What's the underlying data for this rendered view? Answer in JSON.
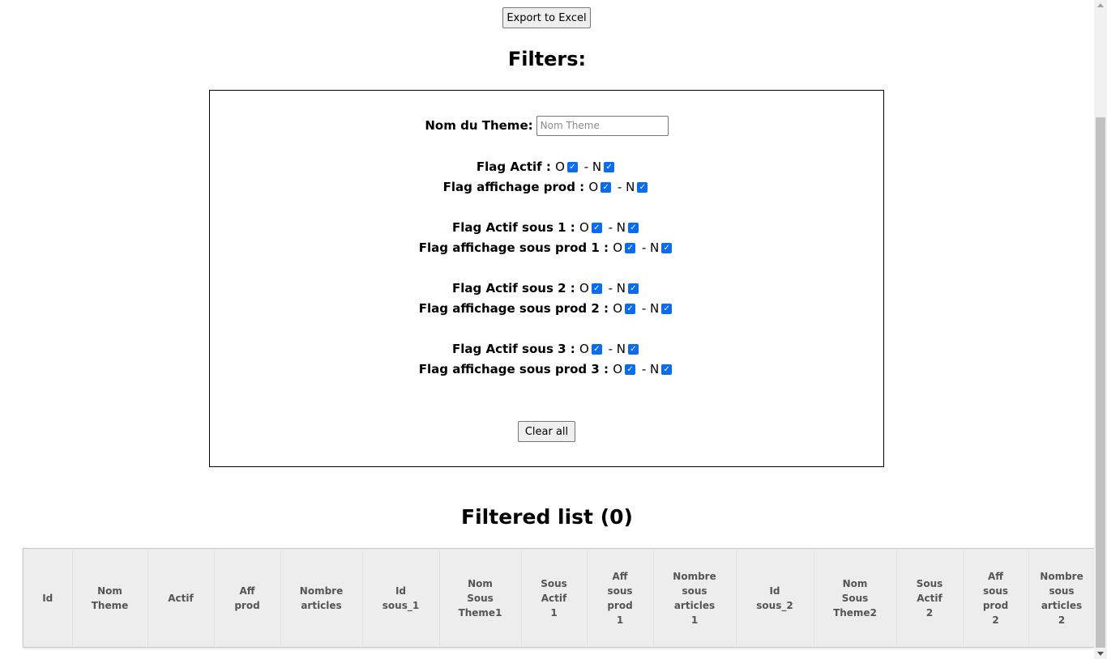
{
  "toolbar": {
    "export_label": "Export to Excel"
  },
  "filters": {
    "title": "Filters:",
    "theme_label": "Nom du Theme:",
    "theme_placeholder": "Nom Theme",
    "theme_value": "",
    "option_yes": "O",
    "option_no": " - N",
    "flags": [
      {
        "label": "Flag Actif : ",
        "o_checked": true,
        "n_checked": true
      },
      {
        "label": "Flag affichage prod : ",
        "o_checked": true,
        "n_checked": true
      },
      {
        "label": "Flag Actif sous 1 : ",
        "o_checked": true,
        "n_checked": true
      },
      {
        "label": "Flag affichage sous prod 1 : ",
        "o_checked": true,
        "n_checked": true
      },
      {
        "label": "Flag Actif sous 2 : ",
        "o_checked": true,
        "n_checked": true
      },
      {
        "label": "Flag affichage sous prod 2 : ",
        "o_checked": true,
        "n_checked": true
      },
      {
        "label": "Flag Actif sous 3 : ",
        "o_checked": true,
        "n_checked": true
      },
      {
        "label": "Flag affichage sous prod 3 : ",
        "o_checked": true,
        "n_checked": true
      }
    ],
    "clear_label": "Clear all"
  },
  "list": {
    "title": "Filtered list (0)",
    "columns": [
      "Id",
      "Nom\nTheme",
      "Actif",
      "Aff\nprod",
      "Nombre\narticles",
      "Id\nsous_1",
      "Nom\nSous\nTheme1",
      "Sous\nActif\n1",
      "Aff\nsous\nprod\n1",
      "Nombre\nsous\narticles\n1",
      "Id\nsous_2",
      "Nom\nSous\nTheme2",
      "Sous\nActif\n2",
      "Aff\nsous\nprod\n2",
      "Nombre\nsous\narticles\n2"
    ],
    "rows": []
  }
}
